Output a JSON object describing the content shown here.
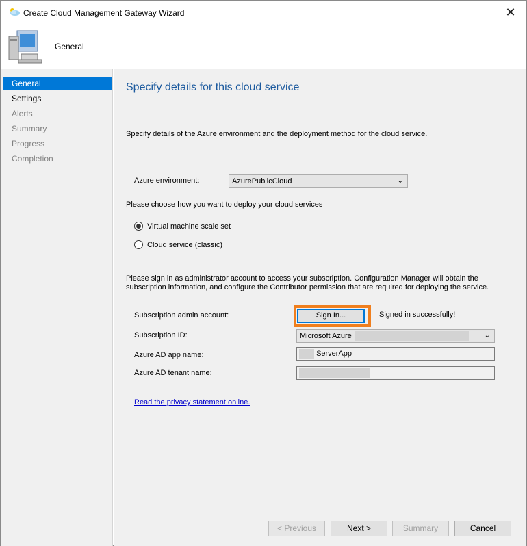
{
  "window": {
    "title": "Create Cloud Management Gateway Wizard"
  },
  "header": {
    "title": "General"
  },
  "sidebar": {
    "items": [
      {
        "label": "General",
        "state": "active"
      },
      {
        "label": "Settings",
        "state": "done"
      },
      {
        "label": "Alerts",
        "state": "pending"
      },
      {
        "label": "Summary",
        "state": "pending"
      },
      {
        "label": "Progress",
        "state": "pending"
      },
      {
        "label": "Completion",
        "state": "pending"
      }
    ]
  },
  "main": {
    "page_title": "Specify details for this cloud service",
    "description": "Specify details of the Azure environment and the deployment method for the cloud service.",
    "azure_env": {
      "label": "Azure environment:",
      "value": "AzurePublicCloud"
    },
    "deploy_prompt": "Please choose how you want to deploy your cloud services",
    "deploy_options": [
      {
        "label": "Virtual machine scale set",
        "selected": true
      },
      {
        "label": "Cloud service (classic)",
        "selected": false
      }
    ],
    "signin_paragraph": "Please sign in as administrator account to access your subscription. Configuration Manager will obtain the subscription information, and configure the Contributor permission that are required for deploying the service.",
    "subscription_admin": {
      "label": "Subscription admin account:",
      "button": "Sign In...",
      "status": "Signed in successfully!"
    },
    "subscription_id": {
      "label": "Subscription ID:",
      "value": "Microsoft Azure"
    },
    "app_name": {
      "label": "Azure AD app name:",
      "value": "ServerApp"
    },
    "tenant_name": {
      "label": "Azure AD tenant name:"
    },
    "privacy_link": "Read the privacy statement online."
  },
  "footer": {
    "previous": "< Previous",
    "next": "Next >",
    "summary": "Summary",
    "cancel": "Cancel"
  },
  "colors": {
    "accent": "#0078d7",
    "highlight": "#f07f1e",
    "title_blue": "#1c5a9e"
  }
}
